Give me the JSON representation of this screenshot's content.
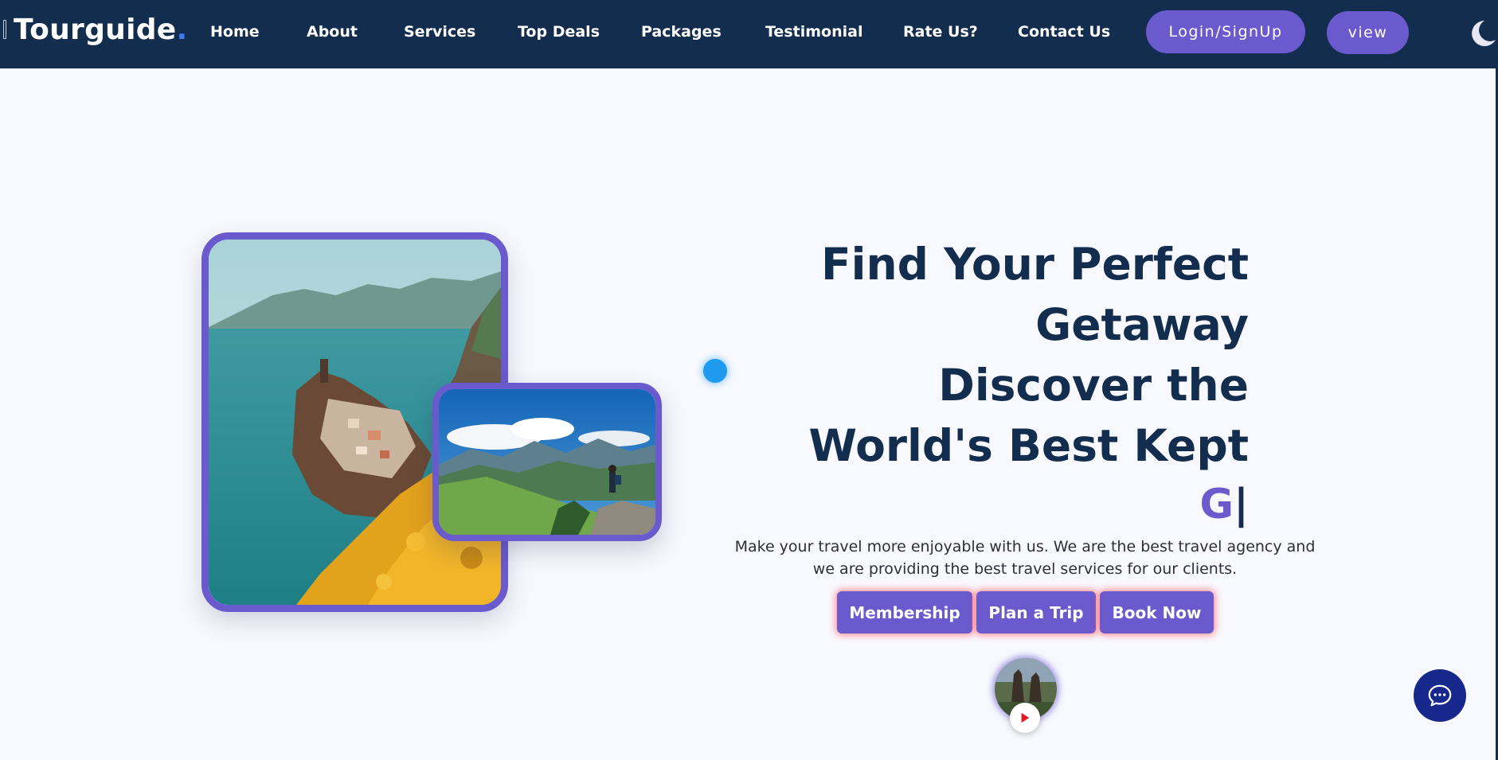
{
  "brand": {
    "name": "Tourguide",
    "dot": "."
  },
  "nav": {
    "links": [
      "Home",
      "About",
      "Services",
      "Top Deals",
      "Packages",
      "Testimonial",
      "Rate Us?",
      "Contact Us"
    ],
    "login_label": "Login/SignUp",
    "view_label": "view",
    "theme_icon": "moon-icon"
  },
  "hero": {
    "heading_lines": [
      "Find Your Perfect",
      "Getaway",
      "Discover the",
      "World's Best Kept"
    ],
    "typed_text": "G",
    "typed_cursor": "|",
    "description": "Make your travel more enjoyable with us. We are the best travel agency and we are providing the best travel services for our clients.",
    "buttons": [
      "Membership",
      "Plan a Trip",
      "Book Now"
    ]
  },
  "icons": {
    "play": "play-icon",
    "chat": "chat-bubble-icon"
  },
  "colors": {
    "navbar": "#132d4f",
    "accent": "#6a5acd",
    "heading": "#132d4f",
    "page_bg": "#f8f9fe",
    "chat_button": "#16288c",
    "dot": "#1e9bf0"
  }
}
